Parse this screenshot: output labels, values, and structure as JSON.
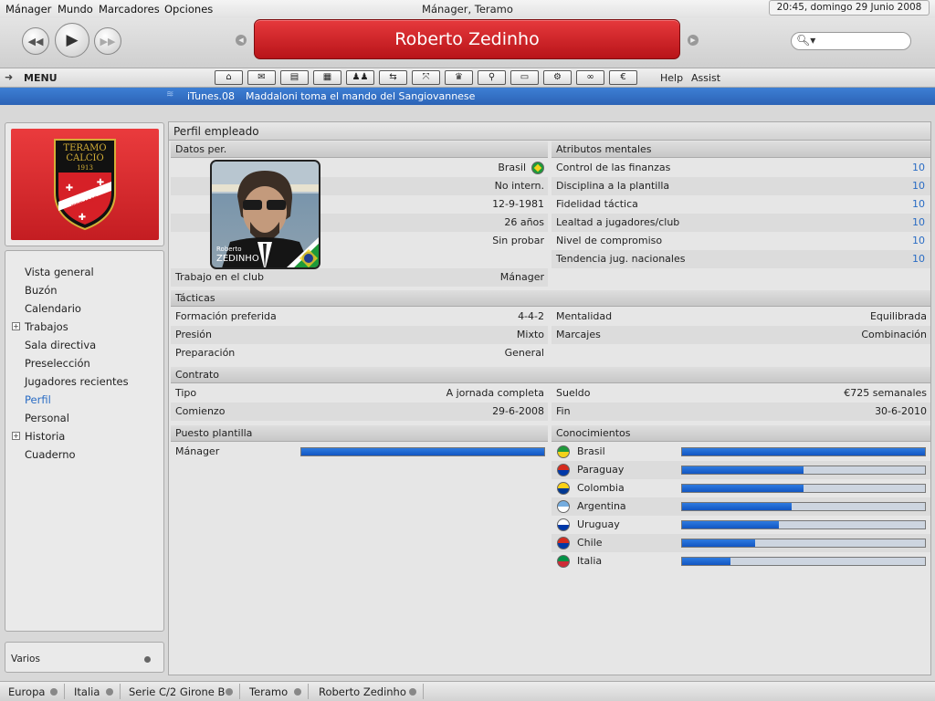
{
  "menubar": {
    "items": [
      "Mánager",
      "Mundo",
      "Marcadores",
      "Opciones"
    ],
    "title": "Mánager, Teramo",
    "clock": "20:45, domingo 29 Junio 2008"
  },
  "toolbar": {
    "banner": "Roberto Zedinho"
  },
  "navbar": {
    "menu_label": "MENU",
    "help": "Help",
    "assist": "Assist"
  },
  "news": {
    "source": "iTunes.08",
    "headline": "Maddaloni toma el mando del Sangiovannese"
  },
  "club_badge": {
    "line1": "TERAMO",
    "line2": "CALCIO",
    "line3": "1913",
    "ribbon": "TERAMO"
  },
  "sidenav": {
    "items": [
      {
        "label": "Vista general"
      },
      {
        "label": "Buzón"
      },
      {
        "label": "Calendario"
      },
      {
        "label": "Trabajos"
      },
      {
        "label": "Sala directiva"
      },
      {
        "label": "Preselección"
      },
      {
        "label": "Jugadores recientes"
      },
      {
        "label": "Perfil"
      },
      {
        "label": "Personal"
      },
      {
        "label": "Historia"
      },
      {
        "label": "Cuaderno"
      }
    ],
    "varios": "Varios"
  },
  "profile": {
    "page_title": "Perfil empleado",
    "datos_header": "Datos per.",
    "photo_first": "Roberto",
    "photo_last": "ZEDINHO",
    "nationality": "Brasil",
    "intl": "No intern.",
    "birthdate": "12-9-1981",
    "age": "26 años",
    "license": "Sin probar",
    "job_label": "Trabajo en el club",
    "job_value": "Mánager"
  },
  "mental": {
    "header": "Atributos mentales",
    "rows": [
      {
        "label": "Control de las finanzas",
        "value": "10"
      },
      {
        "label": "Disciplina a la plantilla",
        "value": "10"
      },
      {
        "label": "Fidelidad táctica",
        "value": "10"
      },
      {
        "label": "Lealtad a jugadores/club",
        "value": "10"
      },
      {
        "label": "Nivel de compromiso",
        "value": "10"
      },
      {
        "label": "Tendencia jug. nacionales",
        "value": "10"
      }
    ]
  },
  "tactics": {
    "header": "Tácticas",
    "formation_label": "Formación preferida",
    "formation_value": "4-4-2",
    "pressing_label": "Presión",
    "pressing_value": "Mixto",
    "prep_label": "Preparación",
    "prep_value": "General",
    "mentality_label": "Mentalidad",
    "mentality_value": "Equilibrada",
    "marking_label": "Marcajes",
    "marking_value": "Combinación"
  },
  "contract": {
    "header": "Contrato",
    "type_label": "Tipo",
    "type_value": "A jornada completa",
    "start_label": "Comienzo",
    "start_value": "29-6-2008",
    "wage_label": "Sueldo",
    "wage_value": "€725 semanales",
    "end_label": "Fin",
    "end_value": "30-6-2010"
  },
  "squad_role": {
    "header": "Puesto plantilla",
    "label": "Mánager",
    "level": 1.0
  },
  "knowledge": {
    "header": "Conocimientos",
    "rows": [
      {
        "label": "Brasil",
        "level": 1.0,
        "colors": [
          "#1e9a3a",
          "#f3d21a"
        ]
      },
      {
        "label": "Paraguay",
        "level": 0.5,
        "colors": [
          "#d52b1e",
          "#0038a8"
        ]
      },
      {
        "label": "Colombia",
        "level": 0.5,
        "colors": [
          "#fcd116",
          "#003893"
        ]
      },
      {
        "label": "Argentina",
        "level": 0.45,
        "colors": [
          "#74acdf",
          "#ffffff"
        ]
      },
      {
        "label": "Uruguay",
        "level": 0.4,
        "colors": [
          "#ffffff",
          "#0038a8"
        ]
      },
      {
        "label": "Chile",
        "level": 0.3,
        "colors": [
          "#d52b1e",
          "#0039a6"
        ]
      },
      {
        "label": "Italia",
        "level": 0.2,
        "colors": [
          "#009246",
          "#ce2b37"
        ]
      }
    ]
  },
  "statusbar": {
    "crumbs": [
      "Europa",
      "Italia",
      "Serie C/2 Girone B",
      "Teramo",
      "Roberto Zedinho"
    ]
  }
}
